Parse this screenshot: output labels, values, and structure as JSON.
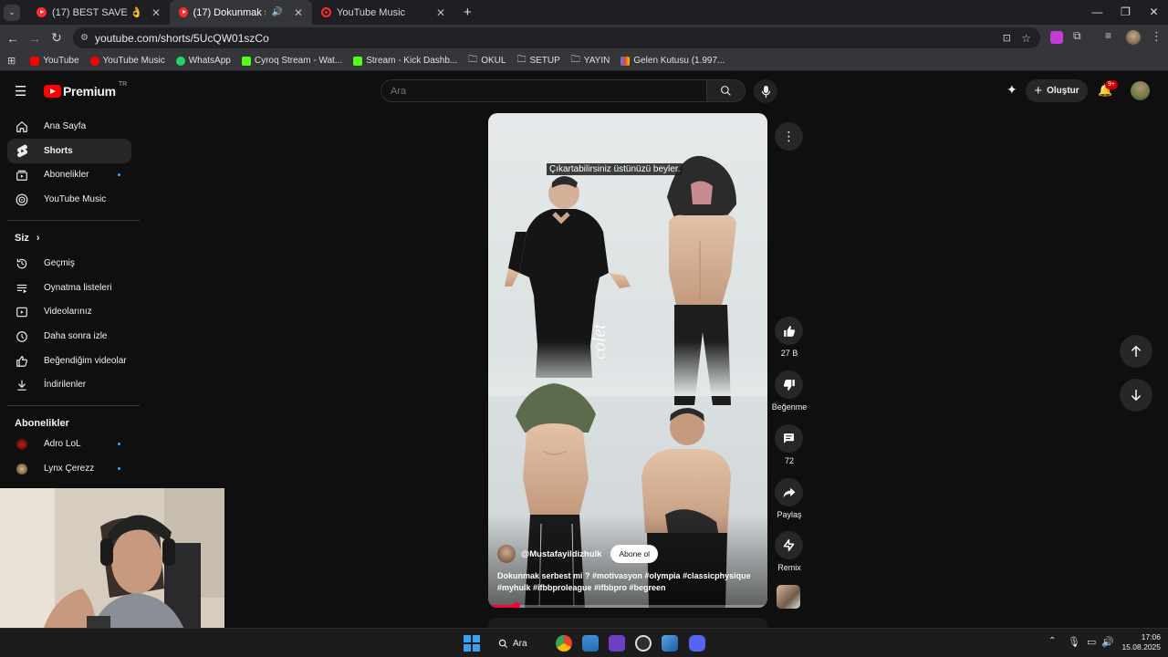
{
  "browser": {
    "tabs": [
      {
        "title": "(17) BEST SAVE 👌 #leagueofle",
        "active": false
      },
      {
        "title": "(17) Dokunmak serbest mi",
        "active": true
      },
      {
        "title": "YouTube Music",
        "active": false
      }
    ],
    "url": "youtube.com/shorts/5UcQW01szCo",
    "bookmarks": [
      {
        "label": "YouTube",
        "icon": "youtube-icon",
        "color": "#ff0000"
      },
      {
        "label": "YouTube Music",
        "icon": "youtube-music-icon",
        "color": "#ff0000"
      },
      {
        "label": "WhatsApp",
        "icon": "whatsapp-icon",
        "color": "#25d366"
      },
      {
        "label": "Cyroq Stream - Wat...",
        "icon": "kick-icon",
        "color": "#53fc18"
      },
      {
        "label": "Stream - Kick Dashb...",
        "icon": "kick-icon",
        "color": "#53fc18"
      },
      {
        "label": "OKUL",
        "icon": "folder-icon",
        "color": "#e0e0e0"
      },
      {
        "label": "SETUP",
        "icon": "folder-icon",
        "color": "#e0e0e0"
      },
      {
        "label": "YAYIN",
        "icon": "folder-icon",
        "color": "#e0e0e0"
      },
      {
        "label": "Gelen Kutusu (1.997...",
        "icon": "gmail-icon",
        "color": "#ea4335"
      }
    ]
  },
  "header": {
    "logo_text": "Premium",
    "logo_region": "TR",
    "search_placeholder": "Ara",
    "create_label": "Oluştur",
    "notif_badge": "9+"
  },
  "sidebar": {
    "top": [
      {
        "label": "Ana Sayfa",
        "icon": "home-icon"
      },
      {
        "label": "Shorts",
        "icon": "shorts-icon",
        "active": true
      },
      {
        "label": "Abonelikler",
        "icon": "subscriptions-icon",
        "dot": true
      },
      {
        "label": "YouTube Music",
        "icon": "youtube-music-icon"
      }
    ],
    "you_title": "Siz",
    "you": [
      {
        "label": "Geçmiş",
        "icon": "history-icon"
      },
      {
        "label": "Oynatma listeleri",
        "icon": "playlists-icon"
      },
      {
        "label": "Videolarınız",
        "icon": "your-videos-icon"
      },
      {
        "label": "Daha sonra izle",
        "icon": "watch-later-icon"
      },
      {
        "label": "Beğendiğim videolar",
        "icon": "liked-icon"
      },
      {
        "label": "İndirilenler",
        "icon": "downloads-icon"
      }
    ],
    "subs_title": "Abonelikler",
    "subs": [
      {
        "label": "Adro LoL",
        "dot": true
      },
      {
        "label": "Lynx Çerezz",
        "dot": true
      }
    ]
  },
  "short": {
    "caption": "Çıkartabilirsiniz üstünüzü beyler.",
    "watermark": "colet",
    "channel": "@Mustafayildizhulk",
    "subscribe_label": "Abone ol",
    "description_line1": "Dokunmak serbest mi ? #motivasyon #olympia #classicphysique",
    "description_line2": "#myhulk #ifbbproleague #ifbbpro #begreen",
    "progress": 0.1,
    "likes": "27 B",
    "dislike_label": "Beğenme",
    "comments": "72",
    "share_label": "Paylaş",
    "remix_label": "Remix"
  },
  "taskbar": {
    "search_label": "Ara",
    "time": "17:06",
    "date": "15.08.2025"
  },
  "colors": {
    "youtube_red": "#ff0000",
    "accent_blue": "#3ea6ff"
  }
}
